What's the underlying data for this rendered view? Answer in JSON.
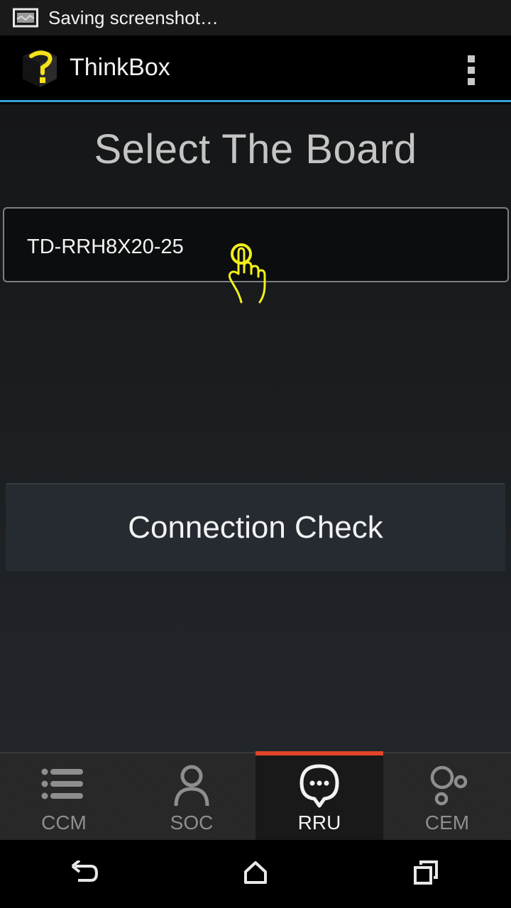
{
  "status_bar": {
    "notification": "Saving screenshot…",
    "icon": "screenshot-icon"
  },
  "action_bar": {
    "title": "ThinkBox",
    "logo": "thinkbox-logo",
    "menu_icon": "overflow-menu-icon",
    "accent_color": "#33a4dc"
  },
  "main": {
    "heading": "Select The Board",
    "board_select": {
      "value": "TD-RRH8X20-25"
    },
    "connection_button": "Connection Check"
  },
  "tabs": [
    {
      "label": "CCM",
      "icon": "list-icon",
      "active": false
    },
    {
      "label": "SOC",
      "icon": "person-icon",
      "active": false
    },
    {
      "label": "RRU",
      "icon": "chat-bubble-icon",
      "active": true
    },
    {
      "label": "CEM",
      "icon": "bubbles-icon",
      "active": false
    }
  ],
  "tab_indicator_color": "#e2452a",
  "nav": {
    "back": "back-icon",
    "home": "home-icon",
    "recents": "recents-icon"
  }
}
